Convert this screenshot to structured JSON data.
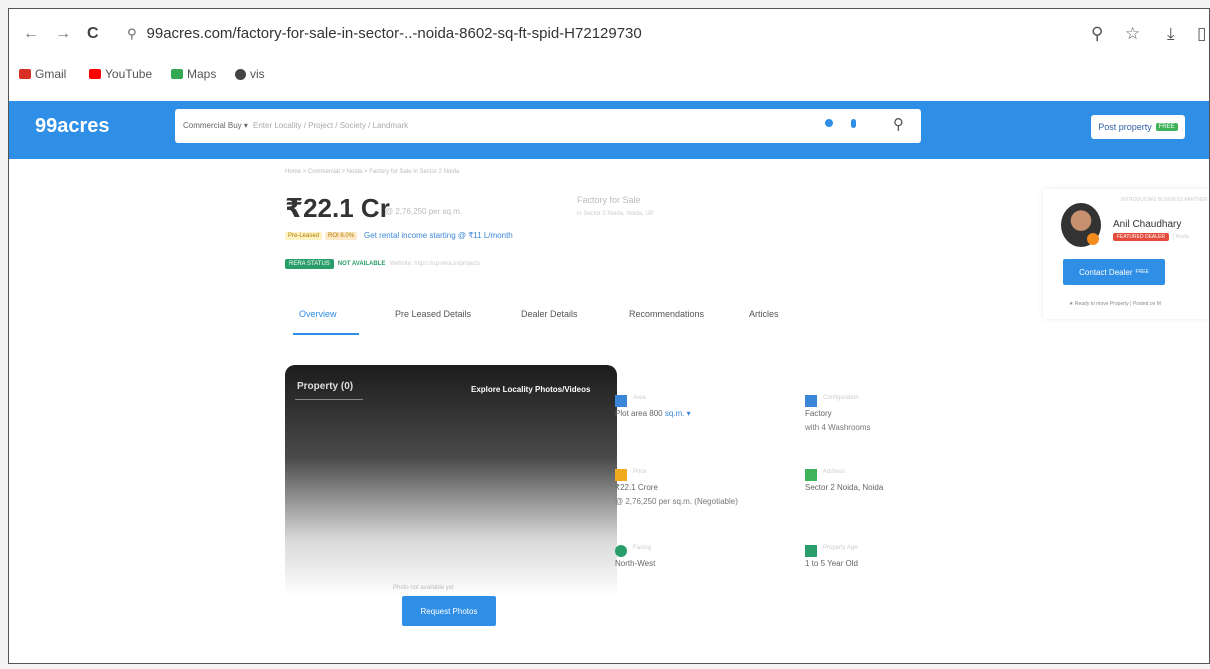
{
  "browser": {
    "url": "99acres.com/factory-for-sale-in-sector-..-noida-8602-sq-ft-spid-H72129730",
    "nav_back": "←",
    "nav_forward": "→",
    "nav_reload": "C",
    "site_icon": "⚲",
    "icons": [
      "zoom-icon",
      "star-icon",
      "download-icon",
      "sidebar-icon"
    ]
  },
  "bookmarks": [
    {
      "label": "Gmail",
      "color": "#d93025"
    },
    {
      "label": "YouTube",
      "color": "#ff0000"
    },
    {
      "label": "Maps",
      "color": "#34a853"
    },
    {
      "label": "vis",
      "color": "#444444"
    }
  ],
  "header": {
    "logo": "99acres",
    "search_category": "Commercial Buy ▾",
    "search_placeholder": "Enter Locality / Project / Society / Landmark",
    "post_label": "Post property",
    "post_badge": "FREE"
  },
  "listing": {
    "breadcrumb": "Home > Commercial > Noida > Factory for Sale in Sector 2 Noida",
    "price": "₹22.1 Cr",
    "price_per_unit": "@ 2,76,250 per sq.m.",
    "property_type": "Factory for Sale",
    "property_location": "in Sector 2 Noida, Noida, UP",
    "tag_pre_leased": "Pre-Leased",
    "tag_roi": "ROI 6.0%",
    "rental_text": "Get rental income starting @ ₹11 L/month",
    "rera_status": "RERA STATUS",
    "rera_value": "NOT AVAILABLE",
    "rera_website": "Website: https://up-rera.in/projects"
  },
  "tabs": [
    {
      "label": "Overview",
      "active": true
    },
    {
      "label": "Pre Leased Details",
      "active": false
    },
    {
      "label": "Dealer Details",
      "active": false
    },
    {
      "label": "Recommendations",
      "active": false
    },
    {
      "label": "Articles",
      "active": false
    }
  ],
  "photos": {
    "property_count": "Property (0)",
    "explore": "Explore Locality Photos/Videos",
    "no_photo": "Photo not available yet",
    "request_btn": "Request Photos"
  },
  "details": [
    {
      "label": "Area",
      "v1": "Plot area 800",
      "unit": "sq.m. ▾",
      "v2": "",
      "color": "#3b86d6"
    },
    {
      "label": "Configuration",
      "v1": "Factory",
      "unit": "",
      "v2": "with 4 Washrooms",
      "color": "#3b86d6"
    },
    {
      "label": "Price",
      "v1": "₹22.1 Crore",
      "unit": "",
      "v2": "@ 2,76,250 per sq.m. (Negotiable)",
      "color": "#f2a91e"
    },
    {
      "label": "Address",
      "v1": "Sector 2 Noida, Noida",
      "unit": "",
      "v2": "",
      "color": "#3fb35a"
    },
    {
      "label": "Facing",
      "v1": "North-West",
      "unit": "",
      "v2": "",
      "color": "#2a9e6a"
    },
    {
      "label": "Property Age",
      "v1": "1 to 5 Year Old",
      "unit": "",
      "v2": "",
      "color": "#2a9e6a"
    }
  ],
  "dealer": {
    "tiny_heading": "INTRODUCING BUSINESS PARTNER",
    "name": "Anil Chaudhary",
    "badge": "FEATURED DEALER",
    "badge_extra": "| Noida",
    "contact_label": "Contact Dealer",
    "contact_badge": "FREE",
    "ready_text": "★  Ready to move Property  |  Posted on M"
  }
}
